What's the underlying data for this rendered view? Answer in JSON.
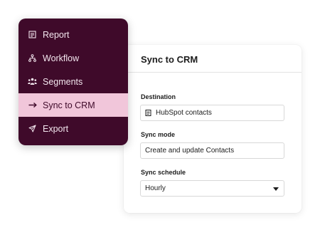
{
  "menu": {
    "items": [
      {
        "label": "Report",
        "icon": "report-icon"
      },
      {
        "label": "Workflow",
        "icon": "workflow-icon"
      },
      {
        "label": "Segments",
        "icon": "segments-icon"
      },
      {
        "label": "Sync to CRM",
        "icon": "arrow-right-icon",
        "active": true
      },
      {
        "label": "Export",
        "icon": "send-icon"
      }
    ]
  },
  "panel": {
    "title": "Sync to CRM",
    "destination": {
      "label": "Destination",
      "value": "HubSpot contacts",
      "icon": "document-icon"
    },
    "sync_mode": {
      "label": "Sync mode",
      "value": "Create and update Contacts"
    },
    "sync_schedule": {
      "label": "Sync schedule",
      "value": "Hourly",
      "icon": "chevron-down-icon"
    }
  },
  "colors": {
    "menu_bg": "#3f0a2a",
    "menu_active_bg": "#f1c6da",
    "menu_text": "#f3e6ee"
  }
}
